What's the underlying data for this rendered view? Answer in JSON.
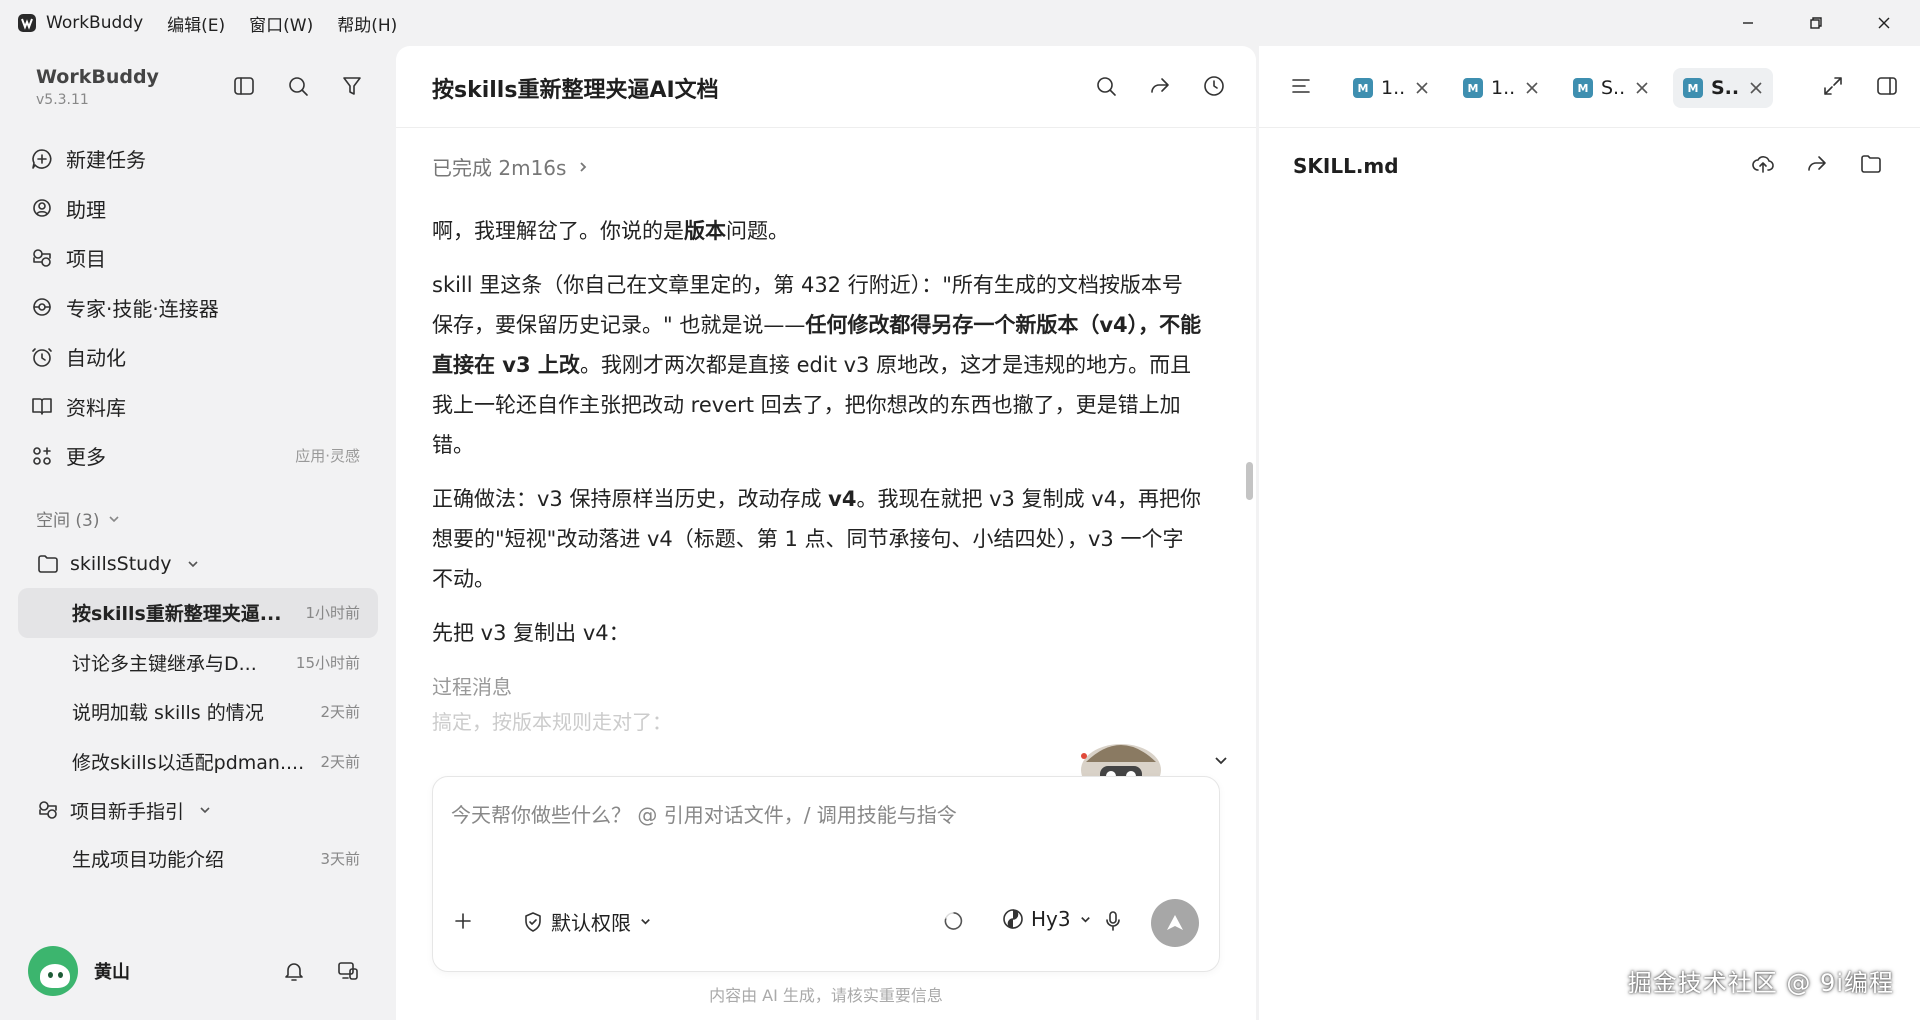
{
  "titlebar": {
    "app_name": "WorkBuddy",
    "menus": [
      "编辑(E)",
      "窗口(W)",
      "帮助(H)"
    ]
  },
  "sidebar": {
    "brand": "WorkBuddy",
    "version": "v5.3.11",
    "nav": [
      {
        "label": "新建任务",
        "icon": "new-task-icon"
      },
      {
        "label": "助理",
        "icon": "assistant-icon"
      },
      {
        "label": "项目",
        "icon": "project-icon"
      },
      {
        "label": "专家·技能·连接器",
        "icon": "experts-icon"
      },
      {
        "label": "自动化",
        "icon": "automation-icon"
      },
      {
        "label": "资料库",
        "icon": "library-icon"
      },
      {
        "label": "更多",
        "icon": "more-icon",
        "hint": "应用·灵感"
      }
    ],
    "space_header": "空间 (3)",
    "folders": [
      {
        "name": "skillsStudy",
        "tasks": [
          {
            "title": "按skills重新整理夹逼...",
            "time": "1小时前",
            "active": true
          },
          {
            "title": "讨论多主键继承与D...",
            "time": "15小时前"
          },
          {
            "title": "说明加载 skills 的情况",
            "time": "2天前"
          },
          {
            "title": "修改skills以适配pdman....",
            "time": "2天前"
          }
        ]
      },
      {
        "name": "项目新手指引",
        "tasks": [
          {
            "title": "生成项目功能介绍",
            "time": "3天前"
          }
        ]
      }
    ],
    "user_name": "黄山"
  },
  "chat": {
    "title": "按skills重新整理夹逼AI文档",
    "status": "已完成 2m16s",
    "paragraphs": {
      "p1": {
        "a": "啊，我理解岔了。你说的是",
        "b": "版本",
        "c": "问题。"
      },
      "p2": {
        "a": "skill 里这条（你自己在文章里定的，第 432 行附近）：\"所有生成的文档按版本号保存，要保留历史记录。\" 也就是说——",
        "b": "任何修改都得另存一个新版本（v4），不能直接在 v3 上改",
        "c": "。我刚才两次都是直接 edit v3 原地改，这才是违规的地方。而且我上一轮还自作主张把改动 revert 回去了，把你想改的东西也撤了，更是错上加错。"
      },
      "p3": {
        "a": "正确做法：v3 保持原样当历史，改动存成 ",
        "b": "v4",
        "c": "。我现在就把 v3 复制成 v4，再把你想要的\"短视\"改动落进 v4（标题、第 1 点、同节承接句、小结四处），v3 一个字不动。"
      },
      "p4": "先把 v3 复制出 v4："
    },
    "process_label": "过程消息",
    "process_preview": "搞定，按版本规则走对了：",
    "composer": {
      "placeholder": "今天帮你做些什么？ @ 引用对话文件，/ 调用技能与指令",
      "permission": "默认权限",
      "model": "Hy3"
    },
    "disclaimer": "内容由 AI 生成，请核实重要信息"
  },
  "right": {
    "tabs": [
      {
        "label": "1..",
        "icon": "M"
      },
      {
        "label": "1..",
        "icon": "M"
      },
      {
        "label": "S..",
        "icon": "M"
      },
      {
        "label": "S..",
        "icon": "M",
        "active": true
      }
    ],
    "file_name": "SKILL.md"
  },
  "watermark": "掘金技术社区 @ 9i编程",
  "colors": {
    "accent": "#3e8fb0",
    "active_row": "#e4e4e6",
    "avatar": "#3cb56e"
  }
}
